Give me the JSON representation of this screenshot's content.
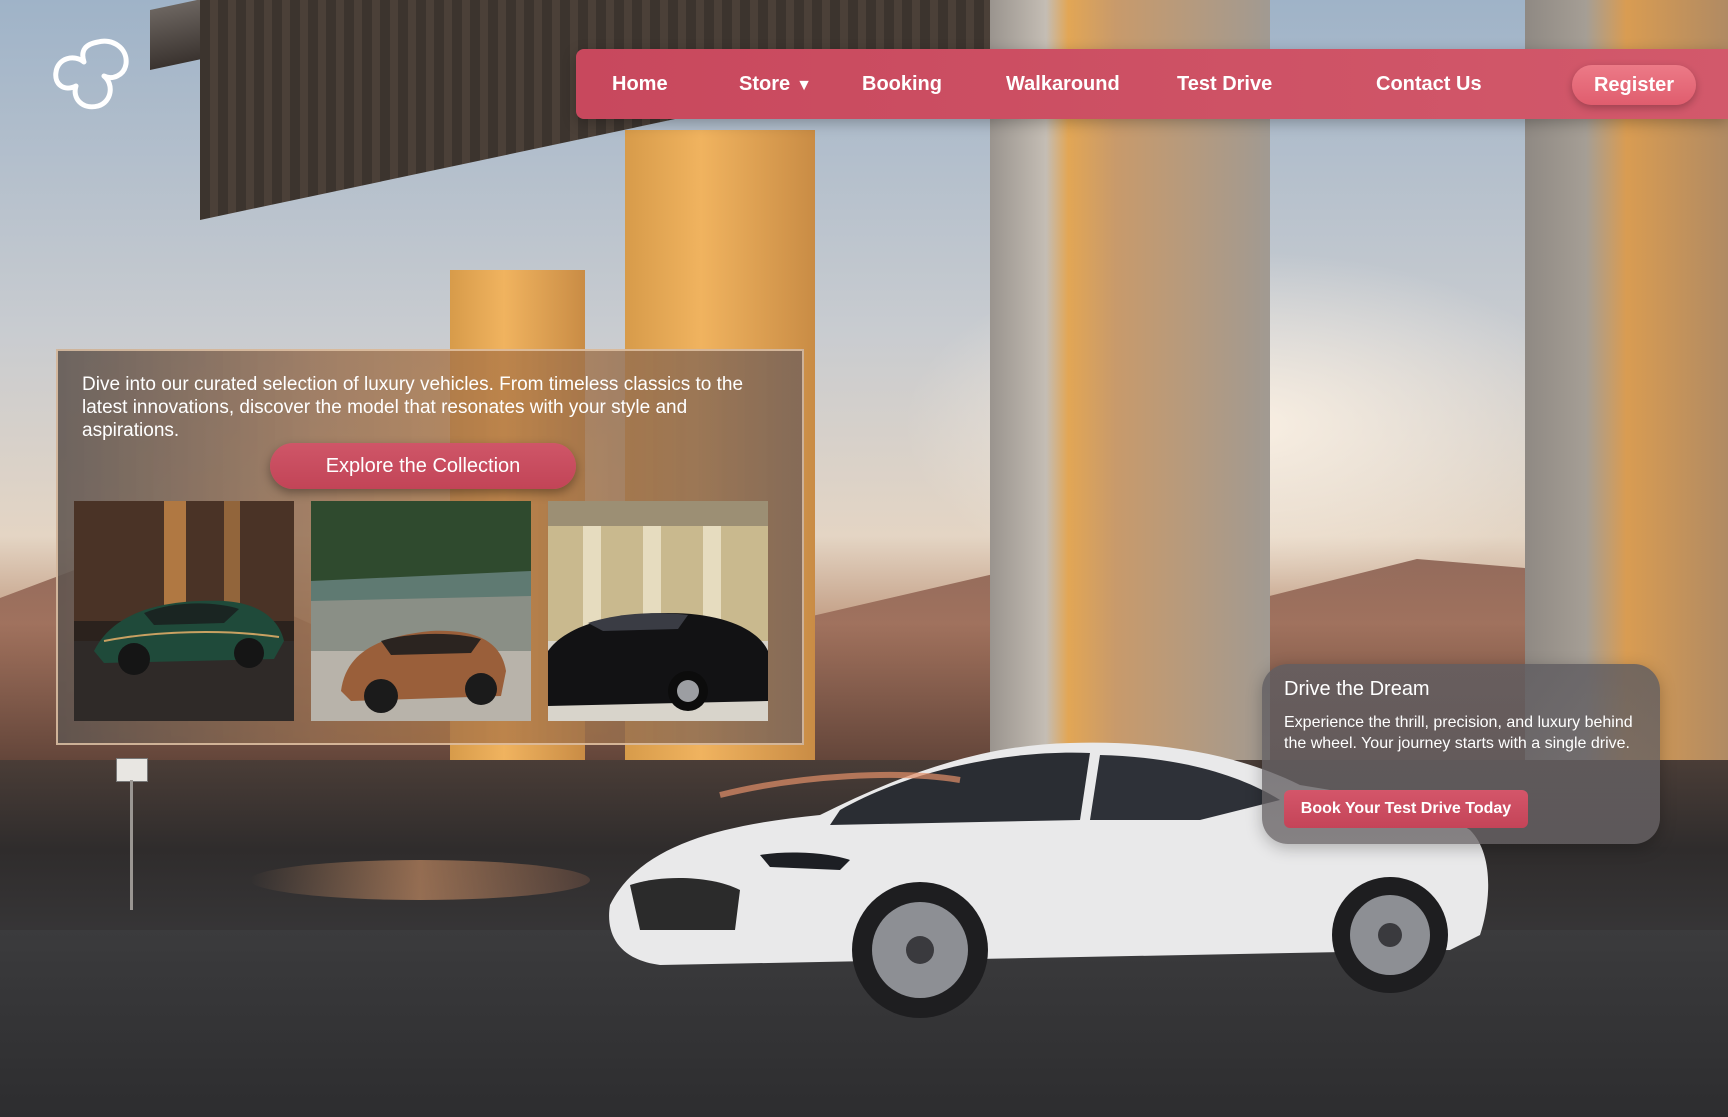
{
  "nav": {
    "items": [
      {
        "label": "Home"
      },
      {
        "label": "Store",
        "has_dropdown": true
      },
      {
        "label": "Booking"
      },
      {
        "label": "Walkaround"
      },
      {
        "label": "Test Drive"
      },
      {
        "label": "Contact Us"
      }
    ],
    "register_label": "Register",
    "caret": "▼"
  },
  "logo": {
    "icon": "infinity-loop-icon"
  },
  "collection": {
    "description": "Dive into our curated selection of luxury vehicles. From timeless classics to the latest innovations, discover the model that resonates with your style and aspirations.",
    "button_label": "Explore the Collection",
    "thumbnails": [
      {
        "icon": "green-concept-car-image"
      },
      {
        "icon": "bronze-suv-image"
      },
      {
        "icon": "black-classic-car-image"
      }
    ]
  },
  "promo": {
    "title": "Drive the Dream",
    "text": "Experience the thrill, precision, and luxury behind the wheel. Your journey starts with a single drive.",
    "button_label": "Book Your Test Drive Today"
  },
  "colors": {
    "accent": "#c8485d",
    "register": "#e76676"
  }
}
